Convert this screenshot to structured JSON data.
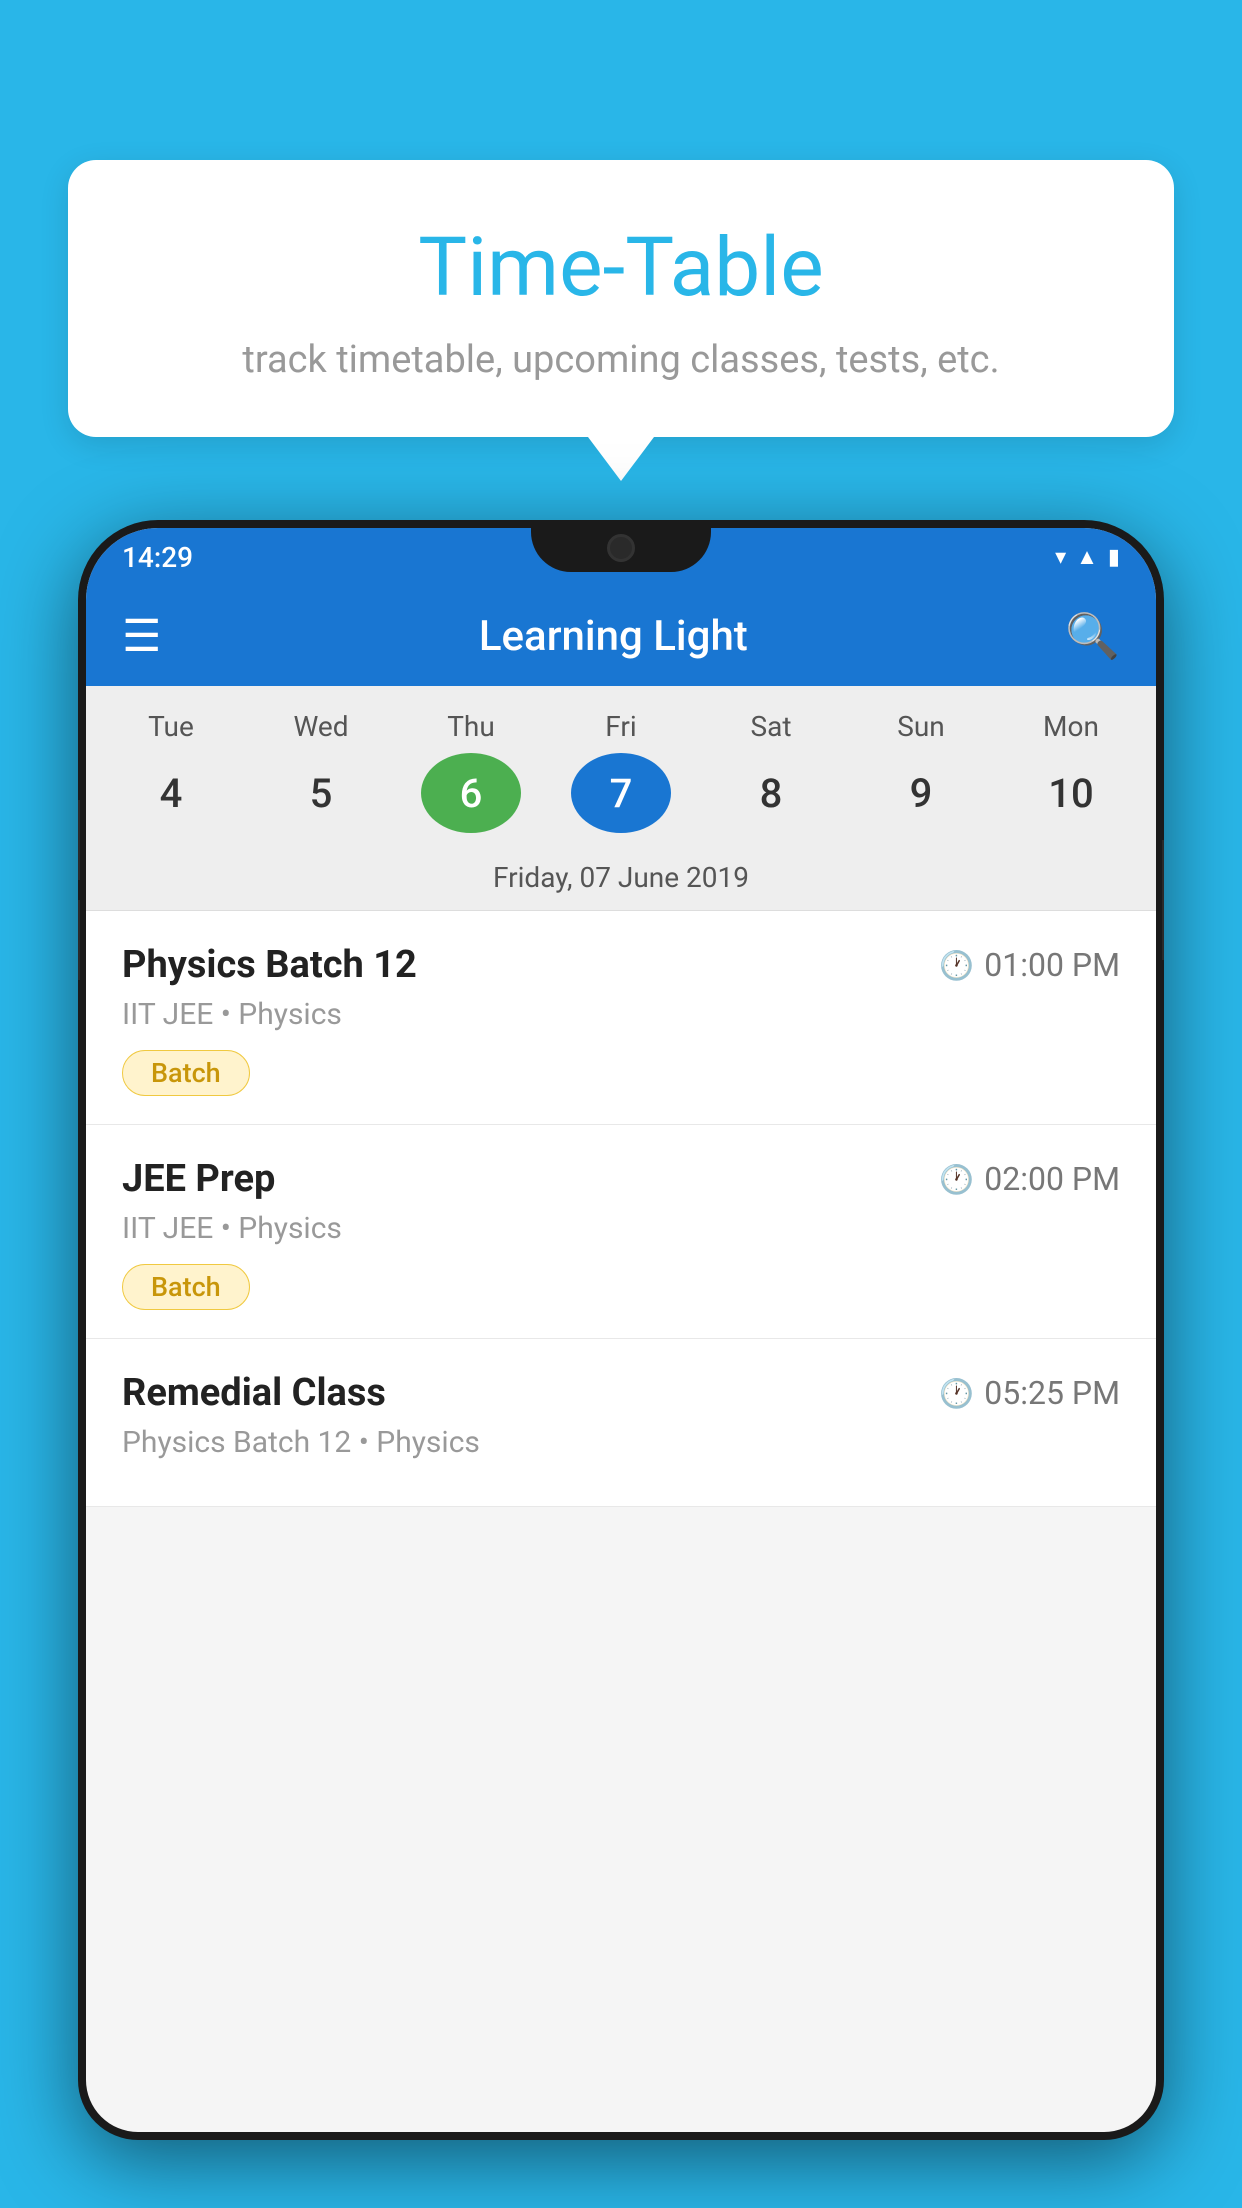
{
  "background_color": "#29b6e8",
  "tooltip": {
    "title": "Time-Table",
    "subtitle": "track timetable, upcoming classes, tests, etc."
  },
  "phone": {
    "status_bar": {
      "time": "14:29",
      "icons": [
        "wifi",
        "signal",
        "battery"
      ]
    },
    "toolbar": {
      "title": "Learning Light",
      "menu_icon": "☰",
      "search_icon": "🔍"
    },
    "calendar": {
      "days": [
        {
          "label": "Tue",
          "num": "4"
        },
        {
          "label": "Wed",
          "num": "5"
        },
        {
          "label": "Thu",
          "num": "6",
          "state": "today"
        },
        {
          "label": "Fri",
          "num": "7",
          "state": "selected"
        },
        {
          "label": "Sat",
          "num": "8"
        },
        {
          "label": "Sun",
          "num": "9"
        },
        {
          "label": "Mon",
          "num": "10"
        }
      ],
      "selected_date": "Friday, 07 June 2019"
    },
    "classes": [
      {
        "name": "Physics Batch 12",
        "time": "01:00 PM",
        "detail": "IIT JEE • Physics",
        "badge": "Batch"
      },
      {
        "name": "JEE Prep",
        "time": "02:00 PM",
        "detail": "IIT JEE • Physics",
        "badge": "Batch"
      },
      {
        "name": "Remedial Class",
        "time": "05:25 PM",
        "detail": "Physics Batch 12 • Physics",
        "badge": null
      }
    ]
  }
}
